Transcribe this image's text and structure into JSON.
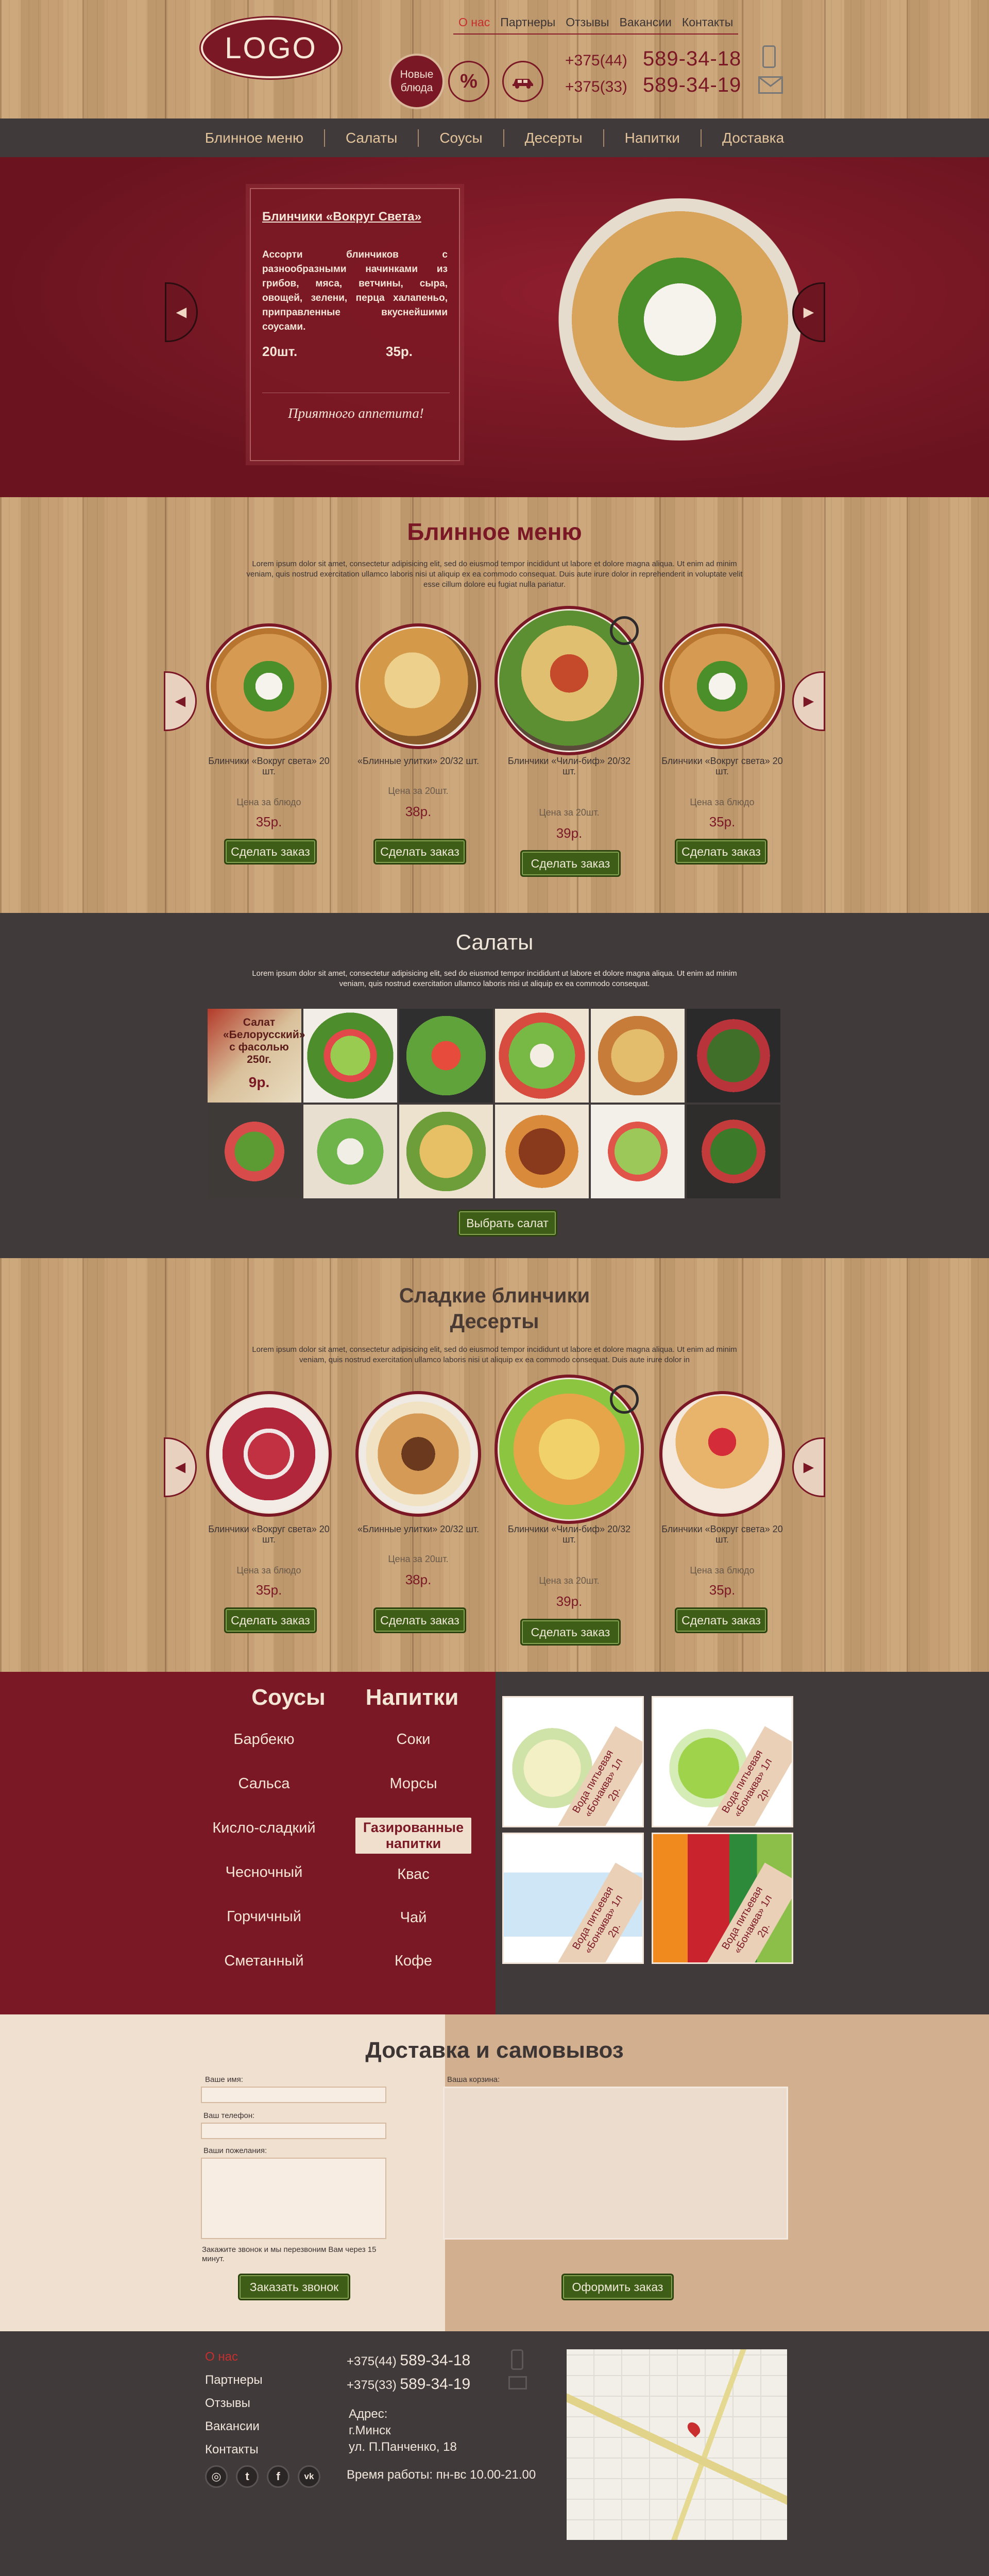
{
  "header": {
    "logo": "LOGO",
    "topnav": [
      "О нас",
      "Партнеры",
      "Отзывы",
      "Вакансии",
      "Контакты"
    ],
    "new_dishes": "Новые блюда",
    "percent": "%",
    "phones": [
      {
        "code": "+375(44)",
        "number": "589-34-18"
      },
      {
        "code": "+375(33)",
        "number": "589-34-19"
      }
    ]
  },
  "mainnav": [
    "Блинное меню",
    "Салаты",
    "Соусы",
    "Десерты",
    "Напитки",
    "Доставка"
  ],
  "hero": {
    "title": "Блинчики «Вокруг Света»",
    "description": "Ассорти блинчиков с разнообразными начинками из грибов, мяса, ветчины, сыра, овощей, зелени, перца халапеньо, приправленные вкуснейшими соусами.",
    "qty": "20шт.",
    "price": "35р.",
    "wish": "Приятного аппетита!"
  },
  "pancakes": {
    "title": "Блинное меню",
    "lorem": "Lorem ipsum dolor sit amet, consectetur adipisicing elit, sed do eiusmod tempor incididunt ut labore et dolore magna aliqua. Ut enim ad minim veniam, quis nostrud exercitation ullamco laboris nisi ut aliquip ex ea commodo consequat. Duis aute irure dolor in reprehenderit in voluptate velit esse cillum dolore eu fugiat nulla pariatur.",
    "items": [
      {
        "name": "Блинчики «Вокруг света» 20 шт.",
        "price_label": "Цена за блюдо",
        "price": "35р.",
        "button": "Сделать заказ"
      },
      {
        "name": "«Блинные улитки» 20/32 шт.",
        "price_label": "Цена за 20шт.",
        "price": "38р.",
        "button": "Сделать заказ"
      },
      {
        "name": "Блинчики «Чили-биф» 20/32 шт.",
        "price_label": "Цена за 20шт.",
        "price": "39р.",
        "button": "Сделать заказ"
      },
      {
        "name": "Блинчики «Вокруг света» 20 шт.",
        "price_label": "Цена за блюдо",
        "price": "35р.",
        "button": "Сделать заказ"
      }
    ]
  },
  "salads": {
    "title": "Салаты",
    "lorem": "Lorem ipsum dolor sit amet, consectetur adipisicing elit, sed do eiusmod tempor incididunt ut labore et dolore magna aliqua. Ut enim ad minim veniam, quis nostrud exercitation ullamco laboris nisi ut aliquip ex ea commodo consequat.",
    "first_caption": "Салат «Белорусский» с фасолью 250г.",
    "first_price": "9р.",
    "button": "Выбрать салат"
  },
  "desserts": {
    "title_line1": "Сладкие блинчики",
    "title_line2": "Десерты",
    "lorem": "Lorem ipsum dolor sit amet, consectetur adipisicing elit, sed do eiusmod tempor incididunt ut labore et dolore magna aliqua. Ut enim ad minim veniam, quis nostrud exercitation ullamco laboris nisi ut aliquip ex ea commodo consequat. Duis aute irure dolor in",
    "items": [
      {
        "name": "Блинчики «Вокруг света» 20 шт.",
        "price_label": "Цена за блюдо",
        "price": "35р.",
        "button": "Сделать заказ"
      },
      {
        "name": "«Блинные улитки» 20/32 шт.",
        "price_label": "Цена за 20шт.",
        "price": "38р.",
        "button": "Сделать заказ"
      },
      {
        "name": "Блинчики «Чили-биф» 20/32 шт.",
        "price_label": "Цена за 20шт.",
        "price": "39р.",
        "button": "Сделать заказ"
      },
      {
        "name": "Блинчики «Вокруг света» 20 шт.",
        "price_label": "Цена за блюдо",
        "price": "35р.",
        "button": "Сделать заказ"
      }
    ]
  },
  "sauces": {
    "title": "Соусы",
    "items": [
      "Барбекю",
      "Сальса",
      "Кисло-сладкий",
      "Чесночный",
      "Горчичный",
      "Сметанный"
    ]
  },
  "drinks": {
    "title": "Напитки",
    "items": [
      "Соки",
      "Морсы",
      "Газированные напитки",
      "Квас",
      "Чай",
      "Кофе"
    ],
    "tiles": [
      {
        "label": "Вода питьевая «Бонаква» 1л",
        "price": "2р."
      },
      {
        "label": "Вода питьевая «Бонаква» 1л",
        "price": "2р."
      },
      {
        "label": "Вода питьевая «Бонаква» 1л",
        "price": "2р."
      },
      {
        "label": "Вода питьевая «Бонаква» 1л",
        "price": "2р."
      }
    ]
  },
  "delivery": {
    "title": "Доставка и самовывоз",
    "name_label": "Ваше имя:",
    "phone_label": "Ваш телефон:",
    "wishes_label": "Ваши пожелания:",
    "callback_note": "Закажите звонок и мы перезвоним Вам через 15 минут.",
    "callback_button": "Заказать звонок",
    "cart_label": "Ваша корзина:",
    "order_button": "Оформить заказ"
  },
  "footer": {
    "links": [
      "О нас",
      "Партнеры",
      "Отзывы",
      "Вакансии",
      "Контакты"
    ],
    "phones": [
      {
        "code": "+375(44)",
        "number": "589-34-18"
      },
      {
        "code": "+375(33)",
        "number": "589-34-19"
      }
    ],
    "address_label": "Адрес:",
    "city": "г.Минск",
    "street": "ул. П.Панченко, 18",
    "hours": "Время работы: пн-вс 10.00-21.00",
    "social": [
      "instagram-icon",
      "twitter-icon",
      "facebook-icon",
      "vk-icon"
    ]
  },
  "colors": {
    "accent": "#7b1826",
    "dark": "#413a3b",
    "button": "#3e5d17",
    "cream": "#f0e0d0"
  }
}
